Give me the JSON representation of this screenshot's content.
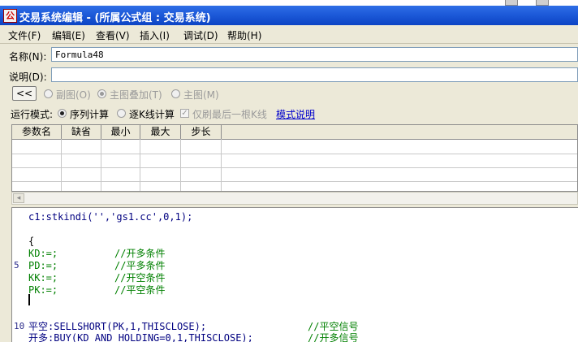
{
  "window": {
    "title": "交易系统编辑 - (所属公式组 : 交易系统)",
    "icon_name": "formula-app-icon",
    "title_bar_color": "#1d5ad9"
  },
  "menu": [
    {
      "label": "文件(F)"
    },
    {
      "label": "编辑(E)"
    },
    {
      "label": "查看(V)"
    },
    {
      "label": "插入(I)"
    },
    {
      "label": "调试(D)"
    },
    {
      "label": "帮助(H)"
    }
  ],
  "form": {
    "name_label": "名称(N):",
    "name_value": "Formula48",
    "desc_label": "说明(D):",
    "desc_value": ""
  },
  "toolbar": {
    "collapse_button": "<<",
    "radio_sub": "副图(O)",
    "radio_overlay": "主图叠加(T)",
    "radio_main": "主图(M)"
  },
  "mode": {
    "label": "运行模式:",
    "sequence": "序列计算",
    "per_bar": "逐K线计算",
    "last_bar_only": "仅刷最后一根K线",
    "help_link": "模式说明"
  },
  "params": {
    "columns": [
      "参数名",
      "缺省",
      "最小",
      "最大",
      "步长"
    ]
  },
  "editor": {
    "line_numbers": [
      "5",
      "10"
    ],
    "lines": [
      {
        "code": "c1:stkindi('','gs1.cc',0,1);",
        "comment": ""
      },
      {
        "code": "",
        "comment": ""
      },
      {
        "code": "{",
        "comment": ""
      },
      {
        "code": "KD:=;",
        "comment": "//开多条件"
      },
      {
        "code": "PD:=;",
        "comment": "//平多条件"
      },
      {
        "code": "KK:=;",
        "comment": "//开空条件"
      },
      {
        "code": "PK:=;",
        "comment": "//平空条件"
      },
      {
        "code": "",
        "comment": ""
      },
      {
        "code": "",
        "comment": ""
      },
      {
        "code": "平空:SELLSHORT(PK,1,THISCLOSE);",
        "comment": "//平空信号"
      },
      {
        "code": "开多:BUY(KD AND HOLDING=0,1,THISCLOSE);",
        "comment": "//开多信号"
      }
    ]
  }
}
